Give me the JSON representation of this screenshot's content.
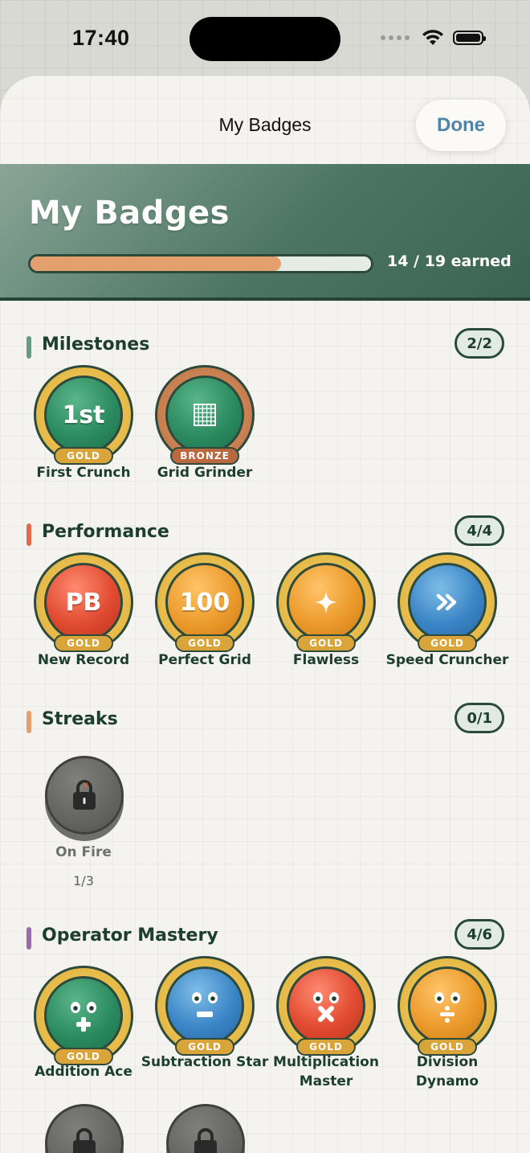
{
  "status_bar": {
    "time": "17:40"
  },
  "nav": {
    "title": "My Badges",
    "done_label": "Done"
  },
  "hero": {
    "title": "My Badges",
    "earned_label": "14 / 19 earned",
    "earned": 14,
    "total": 19,
    "progress_color": "#e3a06c"
  },
  "sections": {
    "milestones": {
      "title": "Milestones",
      "count": "2/2",
      "color": "#6a9a84",
      "badges": [
        {
          "symbol": "1st",
          "tier": "GOLD",
          "name": "First Crunch"
        },
        {
          "symbol": "grid-icon",
          "tier": "BRONZE",
          "name": "Grid Grinder"
        }
      ]
    },
    "performance": {
      "title": "Performance",
      "count": "4/4",
      "color": "#e06a4a",
      "badges": [
        {
          "symbol": "PB",
          "tier": "GOLD",
          "name": "New Record"
        },
        {
          "symbol": "100",
          "tier": "GOLD",
          "name": "Perfect Grid"
        },
        {
          "symbol": "sparkle-icon",
          "tier": "GOLD",
          "name": "Flawless"
        },
        {
          "symbol": "fast-forward-icon",
          "tier": "GOLD",
          "name": "Speed Cruncher"
        }
      ]
    },
    "streaks": {
      "title": "Streaks",
      "count": "0/1",
      "color": "#e3a06c",
      "badges": [
        {
          "symbol": "lock-icon",
          "name": "On Fire",
          "progress": "1/3"
        }
      ]
    },
    "operator": {
      "title": "Operator Mastery",
      "count": "4/6",
      "color": "#9c6aa8",
      "badges": [
        {
          "symbol": "plus-icon",
          "tier": "GOLD",
          "name": "Addition Ace"
        },
        {
          "symbol": "minus-icon",
          "tier": "GOLD",
          "name": "Subtraction Star"
        },
        {
          "symbol": "multiply-icon",
          "tier": "GOLD",
          "name": "Multiplication Master"
        },
        {
          "symbol": "divide-icon",
          "tier": "GOLD",
          "name": "Division Dynamo"
        }
      ]
    }
  }
}
